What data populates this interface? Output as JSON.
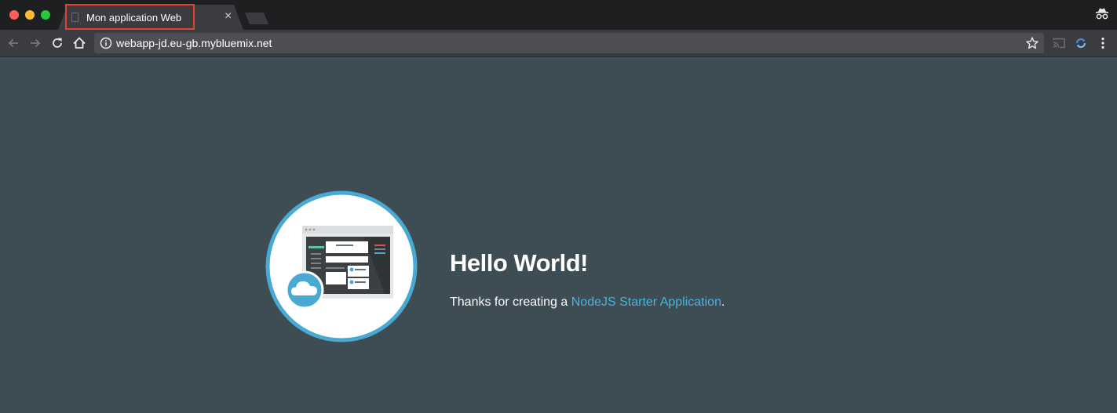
{
  "window": {
    "tab": {
      "title": "Mon application Web",
      "close_glyph": "×"
    }
  },
  "toolbar": {
    "url": "webapp-jd.eu-gb.mybluemix.net",
    "icons": [
      "back-icon",
      "forward-icon",
      "reload-icon",
      "home-icon",
      "info-icon",
      "bookmark-star-icon",
      "cast-icon",
      "extension-icon",
      "menu-icon",
      "incognito-icon"
    ]
  },
  "page": {
    "heading": "Hello World!",
    "text_before": "Thanks for creating a ",
    "link_text": "NodeJS Starter Application",
    "text_after": "."
  },
  "colors": {
    "page_background": "#3e4c54",
    "link": "#48b4e0",
    "circle_ring": "#48a9d2",
    "tab_highlight": "#e8412b"
  }
}
